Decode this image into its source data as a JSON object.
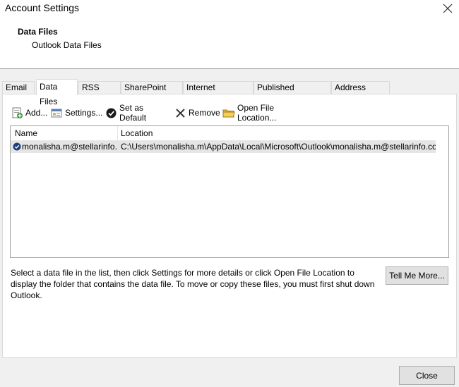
{
  "window": {
    "title": "Account Settings",
    "close_icon": "close-icon"
  },
  "header": {
    "title": "Data Files",
    "subtitle": "Outlook Data Files"
  },
  "tabs": [
    {
      "label": "Email"
    },
    {
      "label": "Data Files",
      "active": true
    },
    {
      "label": "RSS Feeds"
    },
    {
      "label": "SharePoint Lists"
    },
    {
      "label": "Internet Calendars"
    },
    {
      "label": "Published Calendars"
    },
    {
      "label": "Address Books"
    }
  ],
  "toolbar": {
    "add": "Add...",
    "settings": "Settings...",
    "set_default": "Set as Default",
    "remove": "Remove",
    "open_location": "Open File Location..."
  },
  "list": {
    "columns": [
      "Name",
      "Location"
    ],
    "rows": [
      {
        "name": "monalisha.m@stellarinfo...",
        "location": "C:\\Users\\monalisha.m\\AppData\\Local\\Microsoft\\Outlook\\monalisha.m@stellarinfo.co...",
        "default": true,
        "selected": true
      }
    ]
  },
  "help": {
    "text": "Select a data file in the list, then click Settings for more details or click Open File Location to display the folder that contains the data file. To move or copy these files, you must first shut down Outlook.",
    "tell_me_more": "Tell Me More..."
  },
  "footer": {
    "close_label": "Close"
  },
  "colors": {
    "selected_row": "#e5e5e5",
    "button_bg": "#e1e1e1",
    "folder_yellow": "#e8b53a"
  }
}
